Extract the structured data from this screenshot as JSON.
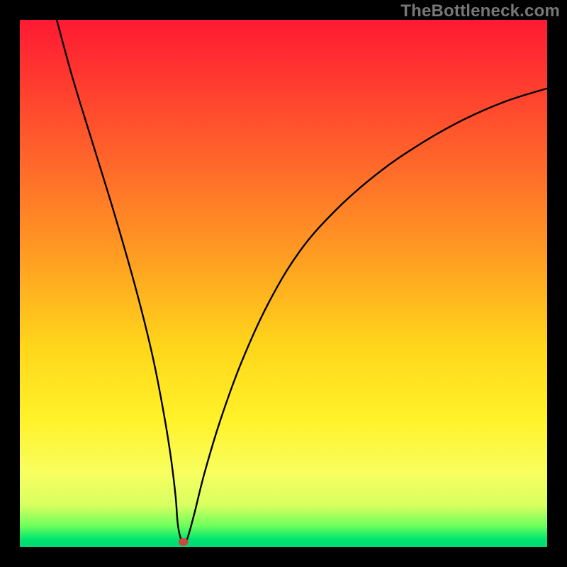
{
  "attribution": "TheBottleneck.com",
  "colors": {
    "frame_bg": "#000000",
    "gradient_stops": [
      "#ff1a33",
      "#ff3b2f",
      "#ff6a2a",
      "#ff9a22",
      "#ffd61a",
      "#fff22a",
      "#f8ff60",
      "#d8ff60",
      "#6cff5c",
      "#00e66f",
      "#00d877"
    ],
    "curve": "#000000",
    "marker": "#c94a3d"
  },
  "chart_data": {
    "type": "line",
    "title": "",
    "xlabel": "",
    "ylabel": "",
    "xlim": [
      0,
      100
    ],
    "ylim": [
      0,
      100
    ],
    "grid": false,
    "legend": false,
    "annotations": [],
    "series": [
      {
        "name": "curve",
        "x": [
          7,
          10,
          14,
          18,
          22,
          25,
          27,
          28.5,
          29.5,
          30,
          30.8,
          31.6,
          33,
          35,
          38,
          42,
          47,
          53,
          60,
          68,
          76,
          84,
          92,
          100
        ],
        "y": [
          100,
          89,
          76,
          63,
          49,
          37,
          27,
          18,
          10,
          4,
          1,
          1.2,
          6,
          14,
          24,
          35,
          46,
          56,
          64,
          71,
          76.5,
          81,
          84.5,
          87
        ]
      }
    ],
    "marker": {
      "x": 31,
      "y": 1,
      "label": ""
    }
  }
}
